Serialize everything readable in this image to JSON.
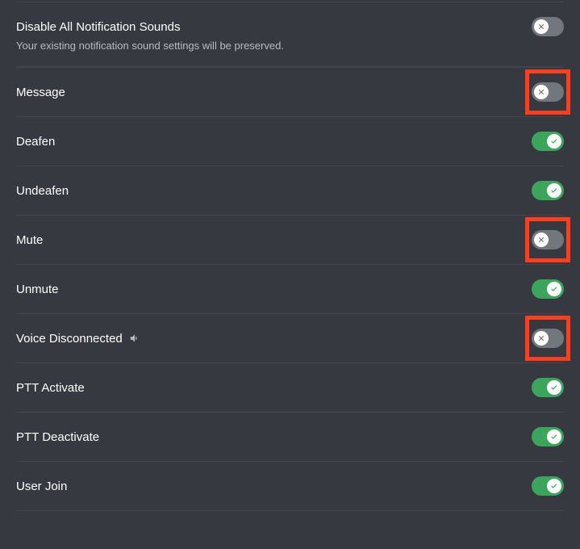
{
  "header": {
    "title": "Disable All Notification Sounds",
    "description": "Your existing notification sound settings will be preserved.",
    "toggle": false
  },
  "items": [
    {
      "label": "Message",
      "toggle": false,
      "highlighted": true,
      "hasSound": false
    },
    {
      "label": "Deafen",
      "toggle": true,
      "highlighted": false,
      "hasSound": false
    },
    {
      "label": "Undeafen",
      "toggle": true,
      "highlighted": false,
      "hasSound": false
    },
    {
      "label": "Mute",
      "toggle": false,
      "highlighted": true,
      "hasSound": false
    },
    {
      "label": "Unmute",
      "toggle": true,
      "highlighted": false,
      "hasSound": false
    },
    {
      "label": "Voice Disconnected",
      "toggle": false,
      "highlighted": true,
      "hasSound": true
    },
    {
      "label": "PTT Activate",
      "toggle": true,
      "highlighted": false,
      "hasSound": false
    },
    {
      "label": "PTT Deactivate",
      "toggle": true,
      "highlighted": false,
      "hasSound": false
    },
    {
      "label": "User Join",
      "toggle": true,
      "highlighted": false,
      "hasSound": false
    }
  ],
  "colors": {
    "background": "#36393f",
    "toggleOn": "#3ba55c",
    "toggleOff": "#72767d",
    "highlight": "#ff3e1d"
  }
}
